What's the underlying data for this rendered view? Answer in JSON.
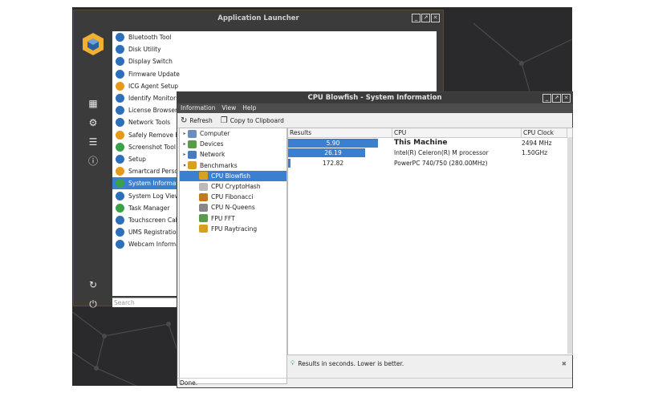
{
  "launcher": {
    "title": "Application Launcher",
    "search_placeholder": "Search",
    "apps": [
      {
        "label": "Bluetooth Tool",
        "color": "#2d6fb8"
      },
      {
        "label": "Disk Utility",
        "color": "#2d6fb8"
      },
      {
        "label": "Display Switch",
        "color": "#2d6fb8"
      },
      {
        "label": "Firmware Update",
        "color": "#2d6fb8"
      },
      {
        "label": "ICG Agent Setup",
        "color": "#e59a1c"
      },
      {
        "label": "Identify Monitors",
        "color": "#2d6fb8"
      },
      {
        "label": "License Browser",
        "color": "#2d6fb8"
      },
      {
        "label": "Network Tools",
        "color": "#2d6fb8"
      },
      {
        "label": "Safely Remove Ha",
        "color": "#e59a1c"
      },
      {
        "label": "Screenshot Tool",
        "color": "#3aa04a"
      },
      {
        "label": "Setup",
        "color": "#2d6fb8"
      },
      {
        "label": "Smartcard Persor",
        "color": "#e59a1c"
      },
      {
        "label": "System Informatio",
        "color": "#3aa04a"
      },
      {
        "label": "System Log Viewe",
        "color": "#2d6fb8"
      },
      {
        "label": "Task Manager",
        "color": "#3aa04a"
      },
      {
        "label": "Touchscreen Calil",
        "color": "#2d6fb8"
      },
      {
        "label": "UMS Registration",
        "color": "#2d6fb8"
      },
      {
        "label": "Webcam Informat",
        "color": "#2d6fb8"
      }
    ]
  },
  "sysinfo": {
    "title": "CPU Blowfish - System Information",
    "menu": [
      "Information",
      "View",
      "Help"
    ],
    "toolbar": {
      "refresh": "Refresh",
      "copy": "Copy to Clipboard"
    },
    "tree": [
      {
        "label": "Computer",
        "arrow": "▸",
        "indent": 0,
        "color": "#6a8fbf"
      },
      {
        "label": "Devices",
        "arrow": "▸",
        "indent": 0,
        "color": "#5a9a4a"
      },
      {
        "label": "Network",
        "arrow": "▸",
        "indent": 0,
        "color": "#4a7ab8"
      },
      {
        "label": "Benchmarks",
        "arrow": "▾",
        "indent": 0,
        "color": "#d8a020"
      },
      {
        "label": "CPU Blowfish",
        "arrow": "",
        "indent": 1,
        "color": "#d8a020"
      },
      {
        "label": "CPU CryptoHash",
        "arrow": "",
        "indent": 1,
        "color": "#bbbbbb"
      },
      {
        "label": "CPU Fibonacci",
        "arrow": "",
        "indent": 1,
        "color": "#c07a20"
      },
      {
        "label": "CPU N-Queens",
        "arrow": "",
        "indent": 1,
        "color": "#888888"
      },
      {
        "label": "FPU FFT",
        "arrow": "",
        "indent": 1,
        "color": "#5a9a4a"
      },
      {
        "label": "FPU Raytracing",
        "arrow": "",
        "indent": 1,
        "color": "#d8a020"
      }
    ],
    "columns": {
      "results": "Results",
      "cpu": "CPU",
      "clock": "CPU Clock"
    },
    "rows": [
      {
        "value": "5.90",
        "fill": 1.0,
        "cpu": "This Machine",
        "clock": "2494 MHz",
        "bold": true
      },
      {
        "value": "26.19",
        "fill": 0.86,
        "cpu": "Intel(R) Celeron(R) M processor",
        "clock": "1.50GHz",
        "bold": false
      },
      {
        "value": "172.82",
        "fill": 0.03,
        "cpu": "PowerPC 740/750 (280.00MHz)",
        "clock": "",
        "bold": false
      }
    ],
    "hint": "Results in seconds. Lower is better.",
    "status": "Done."
  },
  "colors": {
    "accent": "#3b80cf",
    "titlebar": "#3b3b3b",
    "desktop": "#2a2a2c"
  }
}
